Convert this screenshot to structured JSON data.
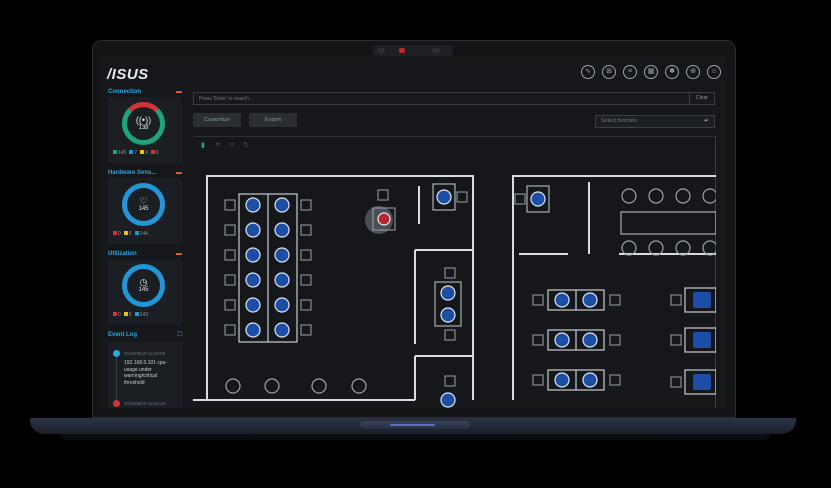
{
  "app": {
    "logo": "/ISUS"
  },
  "top_icons": [
    "graph-icon",
    "network-icon",
    "list-icon",
    "building-icon",
    "settings-icon",
    "globe-icon",
    "user-icon"
  ],
  "widgets": [
    {
      "title": "Connection",
      "value": "138",
      "icon": "((•))",
      "ring_color": "#1fa37a",
      "legend": [
        {
          "color": "#1fa37a",
          "text": "145"
        },
        {
          "color": "#2297d8",
          "text": "7"
        },
        {
          "color": "#e8c21c",
          "text": "0"
        },
        {
          "color": "#d6323a",
          "text": "6"
        }
      ]
    },
    {
      "title": "Hardware Sens...",
      "value": "145",
      "icon": "♡",
      "ring_color": "#2297d8",
      "legend": [
        {
          "color": "#d6323a",
          "text": "0"
        },
        {
          "color": "#e8c21c",
          "text": "0"
        },
        {
          "color": "#2297d8",
          "text": "144"
        }
      ]
    },
    {
      "title": "Utilization",
      "value": "145",
      "icon": "◷",
      "ring_color": "#2297d8",
      "legend": [
        {
          "color": "#d6323a",
          "text": "0"
        },
        {
          "color": "#e8c21c",
          "text": "0"
        },
        {
          "color": "#2297d8",
          "text": "143"
        }
      ]
    }
  ],
  "event_log": {
    "title": "Event Log",
    "items": [
      {
        "time": "2019/09/10 14:10:00",
        "text": "192.168.0.101 cpu-usage under warning/critical threshold",
        "color": "#2aa8e0"
      },
      {
        "time": "2019/09/10 14:10:20",
        "text": "",
        "color": "#d6323a"
      }
    ]
  },
  "search": {
    "placeholder": "Press 'Enter' to search...",
    "clear": "Clear"
  },
  "buttons": {
    "customize": "Customize",
    "export": "Export"
  },
  "select": {
    "placeholder": "Select function"
  }
}
